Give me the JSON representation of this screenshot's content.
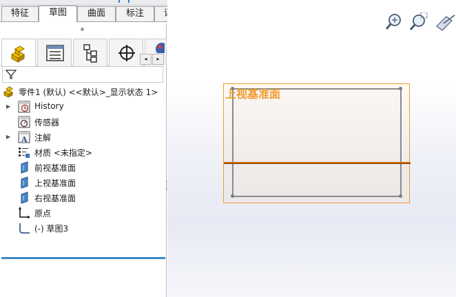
{
  "command_tabs": [
    "特征",
    "草图",
    "曲面",
    "标注",
    "评估"
  ],
  "active_command_tab": "草图",
  "panel_tabs": [
    {
      "icon": "feature-manager-icon",
      "active": true
    },
    {
      "icon": "property-manager-icon",
      "active": false
    },
    {
      "icon": "configuration-manager-icon",
      "active": false
    },
    {
      "icon": "dimxpert-manager-icon",
      "active": false
    },
    {
      "icon": "display-manager-icon",
      "active": false
    }
  ],
  "scroll_arrows": {
    "left": "◂",
    "right": "▸"
  },
  "tree": {
    "root": "零件1 (默认) <<默认>_显示状态 1>",
    "items": [
      {
        "label": "History",
        "icon": "history-icon",
        "expandable": true
      },
      {
        "label": "传感器",
        "icon": "sensors-icon",
        "expandable": false
      },
      {
        "label": "注解",
        "icon": "annotations-icon",
        "expandable": true
      },
      {
        "label": "材质 <未指定>",
        "icon": "material-icon",
        "expandable": false
      },
      {
        "label": "前视基准面",
        "icon": "plane-icon",
        "expandable": false
      },
      {
        "label": "上视基准面",
        "icon": "plane-icon",
        "expandable": false
      },
      {
        "label": "右视基准面",
        "icon": "plane-icon",
        "expandable": false
      },
      {
        "label": "原点",
        "icon": "origin-icon",
        "expandable": false
      },
      {
        "label": "(-) 草图3",
        "icon": "sketch-icon",
        "expandable": false
      }
    ]
  },
  "viewport": {
    "plane_label": "上视基准面",
    "tools": [
      "zoom-to-fit-icon",
      "zoom-to-area-icon",
      "previous-view-icon"
    ]
  },
  "colors": {
    "plane_highlight": "#f39a2d",
    "selection_line": "#d96a00",
    "tree_end_bar": "#3b8ac6"
  }
}
